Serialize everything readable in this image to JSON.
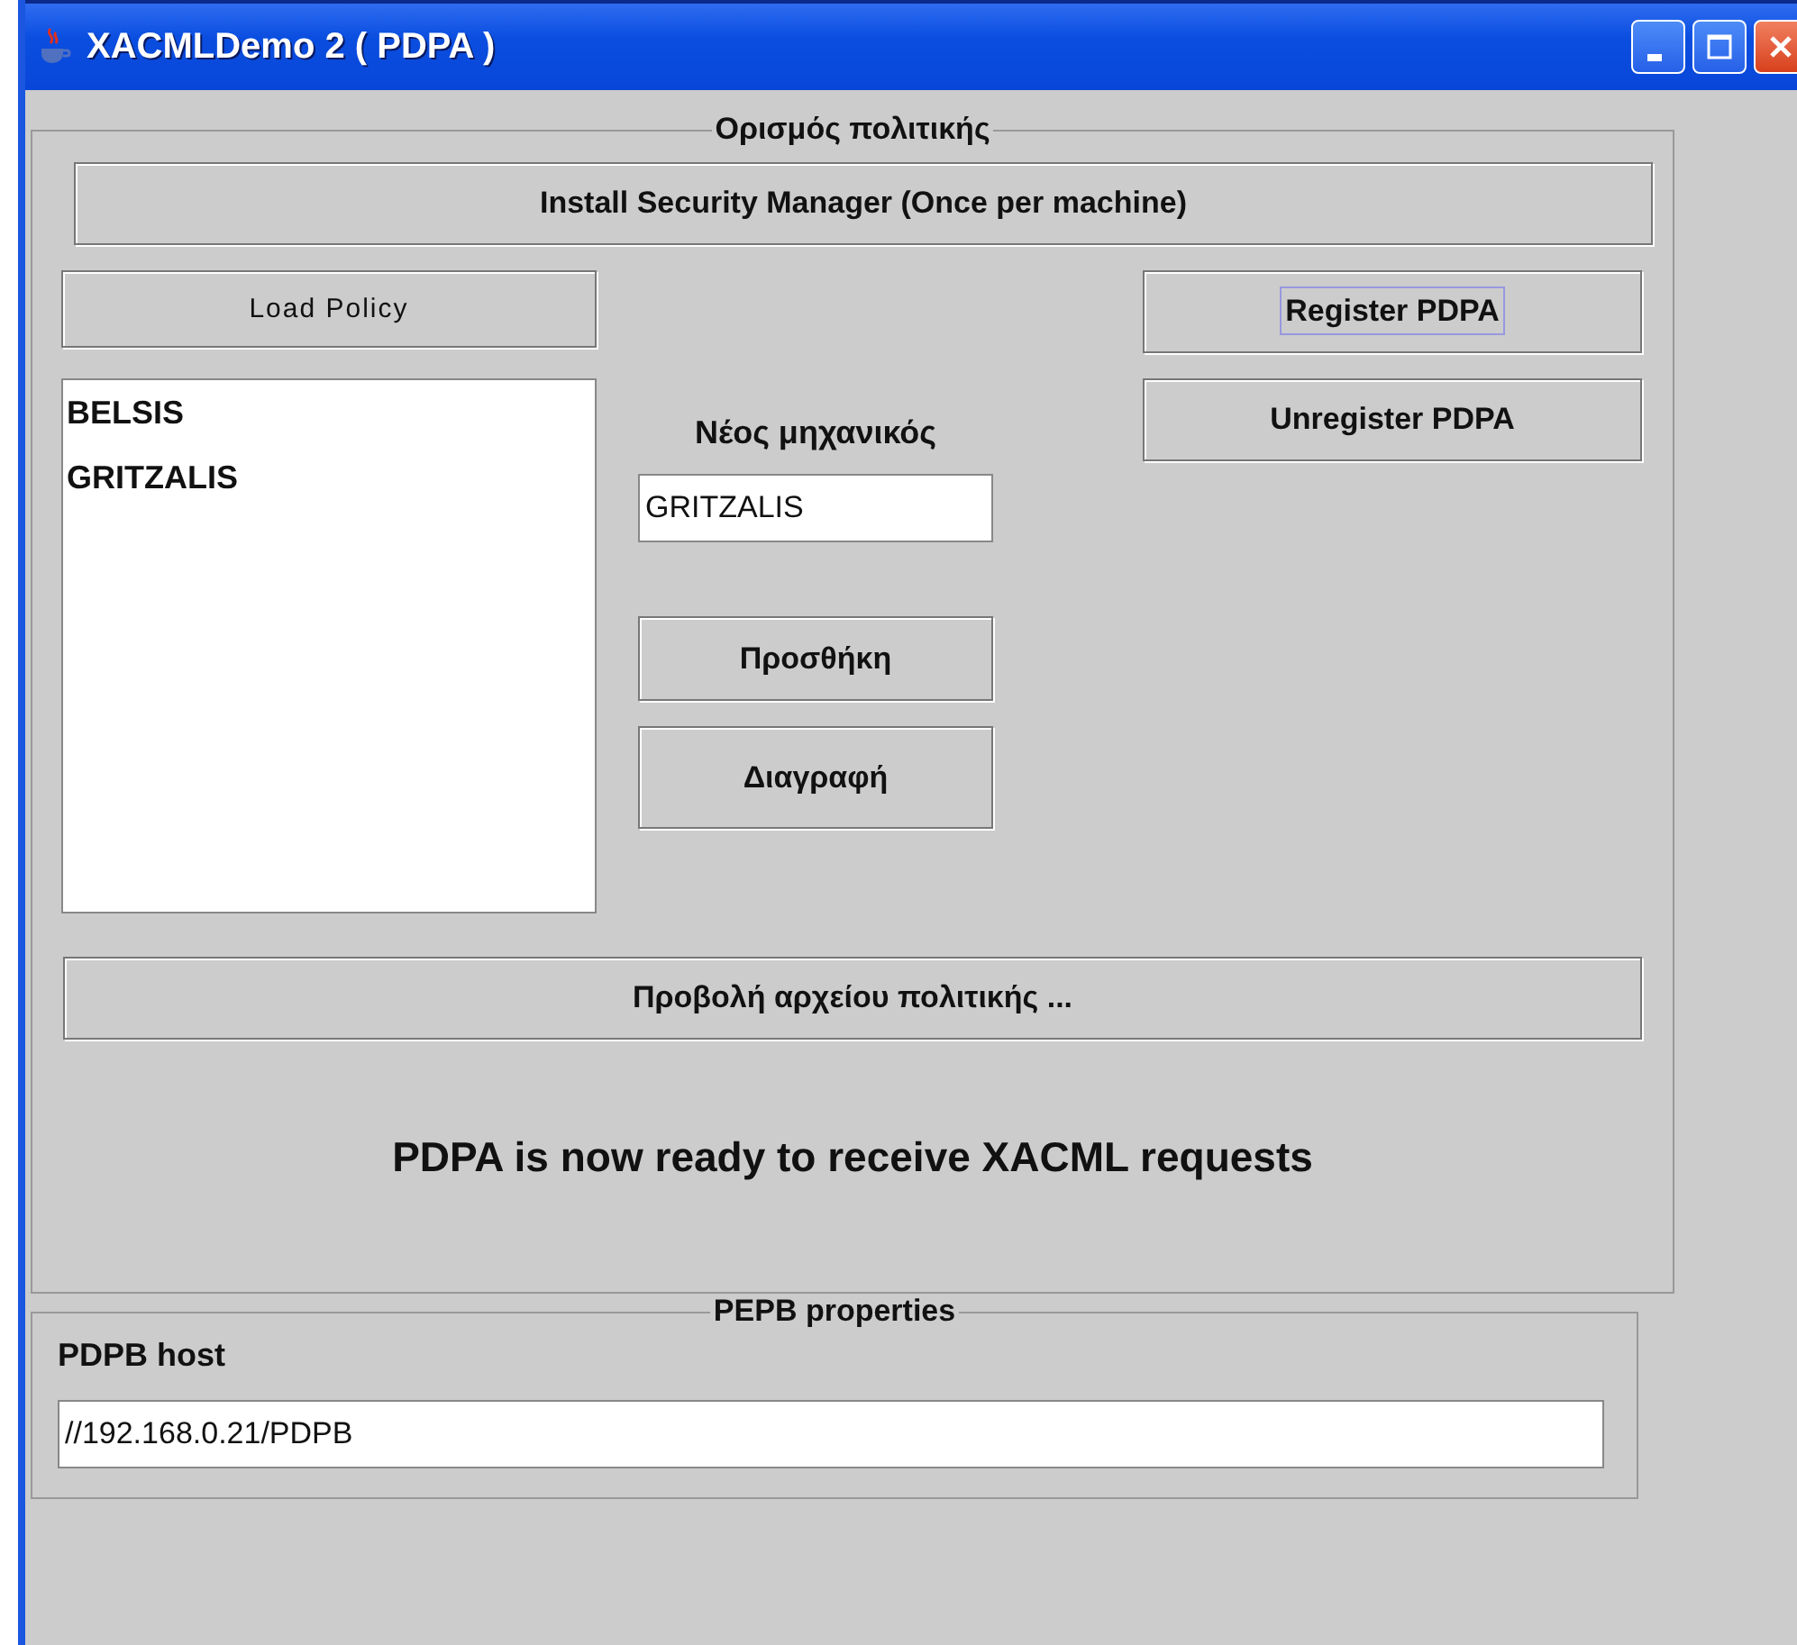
{
  "window": {
    "title": "XACMLDemo 2 ( PDPA )"
  },
  "policy_panel": {
    "legend": "Ορισμός πολιτικής",
    "install_button": "Install Security Manager (Once per machine)",
    "load_button": "Load Policy",
    "engineers": [
      {
        "name": "BELSIS",
        "selected": false
      },
      {
        "name": "GRITZALIS",
        "selected": false
      }
    ],
    "new_engineer_label": "Νέος μηχανικός",
    "new_engineer_value": "GRITZALIS",
    "add_button": "Προσθήκη",
    "delete_button": "Διαγραφή",
    "register_buttons": [
      {
        "label": "Register PDPA",
        "focused": true
      },
      {
        "label": "Unregister PDPA",
        "focused": false
      }
    ],
    "view_button": "Προβολή αρχείου πολιτικής ...",
    "status": "PDPA is now ready to receive XACML requests"
  },
  "pepb_panel": {
    "legend": "PEPB properties",
    "host_label": "PDPB host",
    "host_value": "//192.168.0.21/PDPB"
  }
}
